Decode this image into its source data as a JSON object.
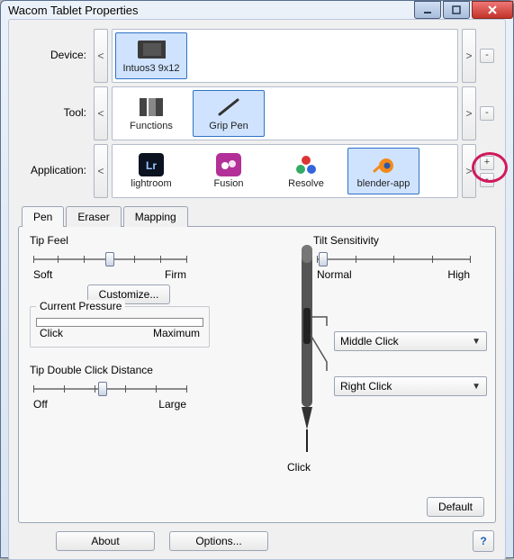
{
  "window": {
    "title": "Wacom Tablet Properties"
  },
  "rows": {
    "device": {
      "label": "Device:",
      "items": [
        {
          "label": "Intuos3 9x12"
        }
      ],
      "selected": 0
    },
    "tool": {
      "label": "Tool:",
      "items": [
        {
          "label": "Functions"
        },
        {
          "label": "Grip Pen"
        }
      ],
      "selected": 1
    },
    "app": {
      "label": "Application:",
      "items": [
        {
          "label": "lightroom"
        },
        {
          "label": "Fusion"
        },
        {
          "label": "Resolve"
        },
        {
          "label": "blender-app"
        }
      ],
      "selected": 3
    }
  },
  "scroll": {
    "left": "<",
    "right": ">"
  },
  "side": {
    "plus": "+",
    "minus": "-"
  },
  "tabs": {
    "pen": "Pen",
    "eraser": "Eraser",
    "mapping": "Mapping"
  },
  "pen": {
    "tipfeel": {
      "title": "Tip Feel",
      "left": "Soft",
      "right": "Firm"
    },
    "customize": "Customize...",
    "pressure": {
      "title": "Current Pressure",
      "left": "Click",
      "right": "Maximum"
    },
    "dblclick": {
      "title": "Tip Double Click Distance",
      "left": "Off",
      "right": "Large"
    },
    "tilt": {
      "title": "Tilt Sensitivity",
      "left": "Normal",
      "right": "High"
    },
    "upper": "Middle Click",
    "lower": "Right Click",
    "tip": "Click",
    "default": "Default"
  },
  "footer": {
    "about": "About",
    "options": "Options...",
    "help": "?"
  }
}
